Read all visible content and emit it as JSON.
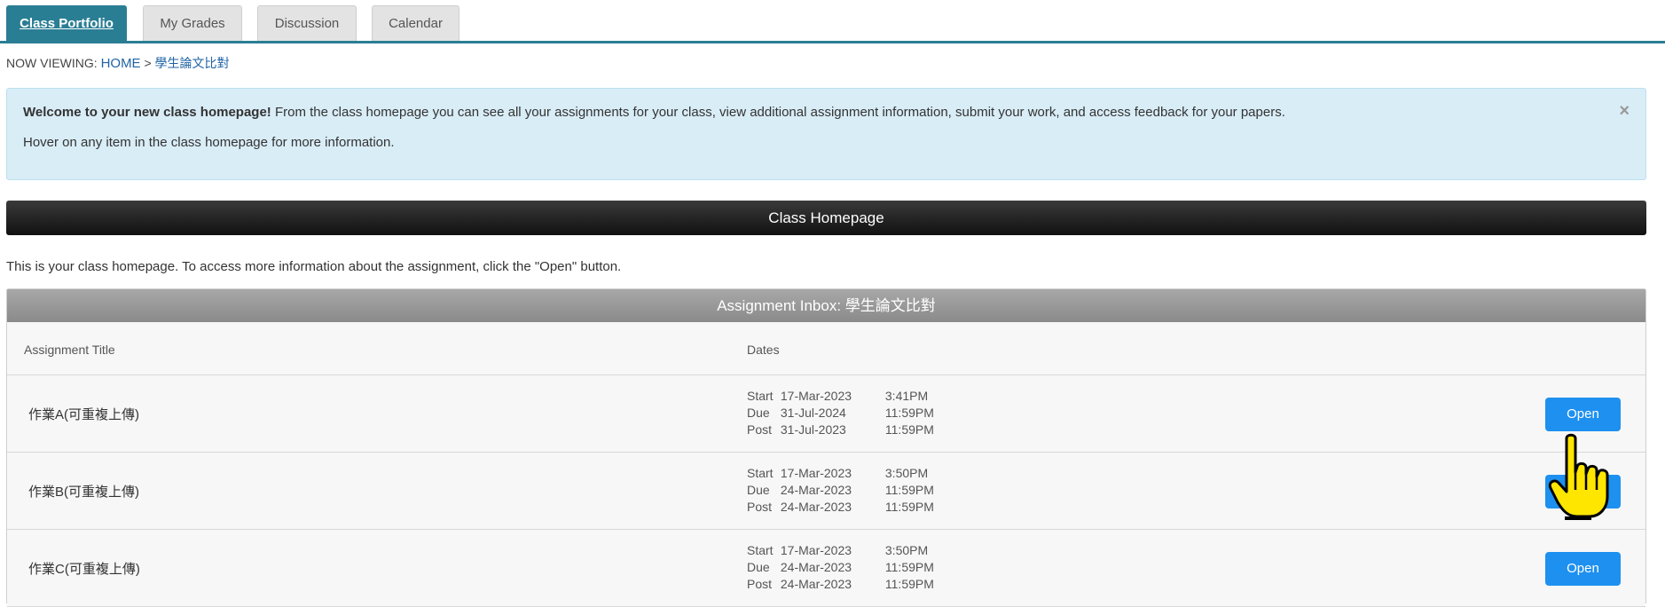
{
  "tabs": [
    {
      "label": "Class Portfolio",
      "active": true
    },
    {
      "label": "My Grades",
      "active": false
    },
    {
      "label": "Discussion",
      "active": false
    },
    {
      "label": "Calendar",
      "active": false
    }
  ],
  "breadcrumb": {
    "prefix": "NOW VIEWING:",
    "home": "HOME",
    "separator": ">",
    "current": "學生論文比對"
  },
  "alert": {
    "bold": "Welcome to your new class homepage!",
    "text": " From the class homepage you can see all your assignments for your class, view additional assignment information, submit your work, and access feedback for your papers.",
    "line2": "Hover on any item in the class homepage for more information.",
    "close": "×"
  },
  "homepage_header": "Class Homepage",
  "intro": "This is your class homepage. To access more information about the assignment, click the \"Open\" button.",
  "inbox": {
    "title": "Assignment Inbox: 學生論文比對",
    "col_title": "Assignment Title",
    "col_dates": "Dates",
    "rows": [
      {
        "title": "作業A(可重複上傳)",
        "dates": [
          {
            "label": "Start",
            "date": "17-Mar-2023",
            "time": "3:41PM"
          },
          {
            "label": "Due",
            "date": "31-Jul-2024",
            "time": "11:59PM"
          },
          {
            "label": "Post",
            "date": "31-Jul-2023",
            "time": "11:59PM"
          }
        ],
        "button": "Open"
      },
      {
        "title": "作業B(可重複上傳)",
        "dates": [
          {
            "label": "Start",
            "date": "17-Mar-2023",
            "time": "3:50PM"
          },
          {
            "label": "Due",
            "date": "24-Mar-2023",
            "time": "11:59PM"
          },
          {
            "label": "Post",
            "date": "24-Mar-2023",
            "time": "11:59PM"
          }
        ],
        "button": "Open"
      },
      {
        "title": "作業C(可重複上傳)",
        "dates": [
          {
            "label": "Start",
            "date": "17-Mar-2023",
            "time": "3:50PM"
          },
          {
            "label": "Due",
            "date": "24-Mar-2023",
            "time": "11:59PM"
          },
          {
            "label": "Post",
            "date": "24-Mar-2023",
            "time": "11:59PM"
          }
        ],
        "button": "Open"
      }
    ]
  },
  "colors": {
    "accent": "#2a7e94",
    "alert_bg": "#d9edf7",
    "button": "#1e90f0",
    "cursor_fill": "#ffe600"
  },
  "icons": {
    "cursor": "hand-pointer-icon",
    "close": "close-icon"
  }
}
